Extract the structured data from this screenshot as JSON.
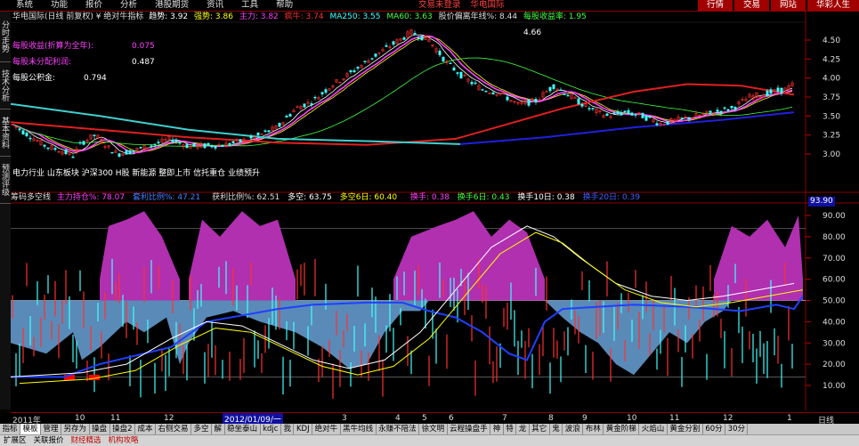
{
  "menu": {
    "items": [
      "系统",
      "功能",
      "报价",
      "分析",
      "港股期货",
      "资讯",
      "工具",
      "帮助"
    ],
    "login_status": "交易未登录",
    "stock_name": "华电国际",
    "right_buttons": [
      "行情",
      "交易",
      "网站",
      "华彩人生"
    ]
  },
  "left_tabs": [
    "分时走势",
    "技术分析",
    "基本资料",
    "预测评级"
  ],
  "header1": {
    "title": "华电国际(日线 前复权) ¥ 绝对牛指标",
    "qushi": "趋势: 3.92",
    "qiangshi": "强势: 3.86",
    "zhuli": "主力: 3.82",
    "fengniu": "疯牛: 3.74",
    "ma250": "MA250: 3.55",
    "ma60": "MA60: 3.63",
    "pianli": "股价偏离年线%: 8.44",
    "shouyi": "每股收益率: 1.95"
  },
  "info": {
    "eps_label": "每股收益(折算为全年):",
    "eps_value": "0.075",
    "undist_label": "每股未分配利润:",
    "undist_value": "0.487",
    "reserve_label": "每股公积金:",
    "reserve_value": "0.794",
    "peak_label": "4.66",
    "industry_line": "电力行业 山东板块 沪深300 H股 新能源 整即上市 信托重仓 业绩预升"
  },
  "header2": {
    "name": "筹码多空线",
    "zhuli_cang": "主力持仓%: 78.07",
    "tuhao": "套利比例%: 47.21",
    "huoli": "获利比例%: 62.51",
    "duokong": "多空: 63.75",
    "duokong6": "多空6日: 60.40",
    "huanshou": "换手: 0.38",
    "huanshou6": "换手6日: 0.43",
    "huanshou10": "换手10日: 0.38",
    "huanshou20": "换手20日: 0.39"
  },
  "price_axis": [
    "4.50",
    "4.25",
    "4.00",
    "3.75",
    "3.50",
    "3.25",
    "3.00"
  ],
  "ind_axis": [
    "90.00",
    "80.00",
    "70.00",
    "60.00",
    "50.00",
    "40.00",
    "30.00",
    "20.00",
    "10.00"
  ],
  "ind_top_value": "93.90",
  "time_axis": {
    "ticks": [
      "2011年",
      "10",
      "11",
      "12",
      "2012/01/09/一",
      "3",
      "4",
      "5",
      "6",
      "7",
      "8",
      "9",
      "10",
      "11",
      "12",
      "1"
    ],
    "dx": "日线"
  },
  "bottom_tabs": [
    "指标",
    "模板",
    "管理",
    "另存为",
    "操盘",
    "操盘2",
    "成本",
    "右侧交易",
    "多空",
    "解",
    "稳坐泰山",
    "kdjc",
    "我",
    "KDJ",
    "绝对牛",
    "黑牛均线",
    "永赚不陪法",
    "徐文明",
    "云程操盘手",
    "神",
    "特",
    "龙",
    "其它",
    "鬼",
    "波浪",
    "布林",
    "黄金阶梯",
    "火焰山",
    "黄金分割",
    "60分",
    "30分"
  ],
  "bottom_links": [
    "扩展区",
    "关联报价",
    "财经精选",
    "机构攻略"
  ],
  "colors": {
    "magenta": "#b030b0",
    "steelblue": "#5a8ab8",
    "red_line": "#e02020",
    "blue_line": "#2020e0",
    "cyan_line": "#40d0d0",
    "accent": "#a00000"
  }
}
